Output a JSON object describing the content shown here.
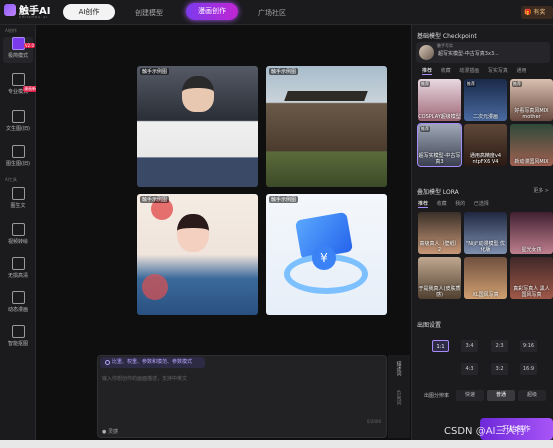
{
  "topbar": {
    "logo_text": "触手AI",
    "logo_sub": "CHUSHOU AI",
    "tabs": [
      "AI创作",
      "创建模型",
      "漫画创作",
      "广场社区"
    ],
    "gift_label": "有奖"
  },
  "sidebar": {
    "section_ai": "AI创作",
    "section_tools": "AI工具",
    "items": [
      {
        "label": "极简模式",
        "badge": "V2.0"
      },
      {
        "label": "专业模式",
        "badge": "漫画新"
      },
      {
        "label": "文生图(旧)"
      },
      {
        "label": "图生图(旧)"
      },
      {
        "label": "图生文"
      },
      {
        "label": "视频转绘"
      },
      {
        "label": "无损高清"
      },
      {
        "label": "动态漫画"
      },
      {
        "label": "智能抠图"
      }
    ]
  },
  "canvas": {
    "images": [
      {
        "tag": "触手示例图"
      },
      {
        "tag": "触手示例图"
      },
      {
        "tag": "触手示例图"
      },
      {
        "tag": "触手示例图"
      }
    ]
  },
  "prompt": {
    "options_label": "比重、权重、参数和模范、参数模式",
    "placeholder": "输入你想创作的画面描述，支持中英文",
    "counter": "0/2000",
    "inspire_label": "灵感",
    "side_tab": "描述词",
    "side_tab2": "负向词"
  },
  "right_panel": {
    "base_model_title": "基础模型 Checkpoint",
    "model_tag": "触手写实",
    "model_name": "超写实模型-中古写真3x3...",
    "model_tabs": [
      "推荐",
      "收藏",
      "动漫插画",
      "写实写真",
      "通用"
    ],
    "models": [
      {
        "name": "COSPLAY超级模型",
        "tag": "推荐"
      },
      {
        "name": "二次元漫画",
        "tag": "推荐"
      },
      {
        "name": "好看写真风MIX mother",
        "tag": "推荐"
      },
      {
        "name": "超写实模型-中古写真3",
        "tag": "推荐"
      },
      {
        "name": "通用高精度v4 ntpFX6 V4",
        "tag": ""
      },
      {
        "name": "新动漫国风MIX",
        "tag": ""
      }
    ],
    "lora_title": "叠加模型 LORA",
    "lora_more": "更多 >",
    "lora_tabs": [
      "推荐",
      "收藏",
      "我的",
      "已选择"
    ],
    "loras": [
      {
        "name": "高级真人（壁纸）2"
      },
      {
        "name": "\"Niji\"动漫模型 优化版"
      },
      {
        "name": "星光女孩"
      },
      {
        "name": "于是我真人(皮肤质感)"
      },
      {
        "name": "XL国风写真"
      },
      {
        "name": "真彩写真人 黑人 国风写真"
      }
    ],
    "ratio_title": "出图设置",
    "ratios": [
      "1:1",
      "3:4",
      "2:3",
      "9:16",
      "4:3",
      "3:2",
      "16:9"
    ],
    "resolution_label": "出图分辨率",
    "resolutions": [
      "快速",
      "普通",
      "超级"
    ],
    "generate_label": "开始创作",
    "watermark": "CSDN @AI三人行"
  }
}
